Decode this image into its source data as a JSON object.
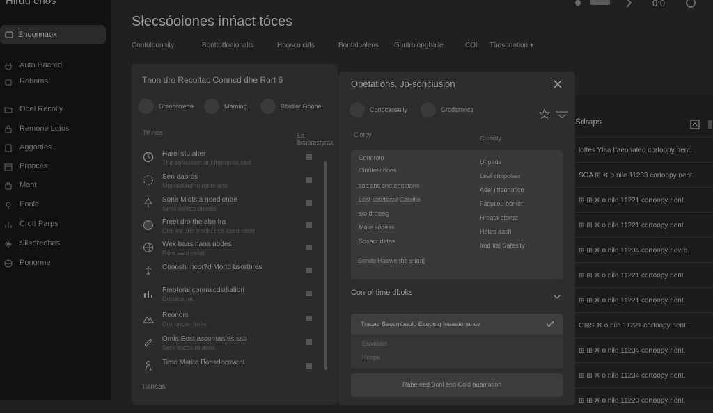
{
  "app": {
    "brand": "Hirdu enos"
  },
  "sidebar": {
    "dashboard_label": "Enoonnaox",
    "items": [
      {
        "label": "Auto Hacred",
        "icon": "plug-icon"
      },
      {
        "label": "Roboms",
        "icon": "robot-icon"
      },
      {
        "label": "Obel Recolly",
        "icon": "folder-icon"
      },
      {
        "label": "Remone Lotos",
        "icon": "lock-icon"
      },
      {
        "label": "Aggorties",
        "icon": "book-icon"
      },
      {
        "label": "Prooces",
        "icon": "calendar-icon"
      },
      {
        "label": "Mant",
        "icon": "bag-icon"
      },
      {
        "label": "Eonle",
        "icon": "pin-icon"
      },
      {
        "label": "Crott Parps",
        "icon": "bars-icon"
      },
      {
        "label": "Sileoreohes",
        "icon": "sparkle-icon"
      },
      {
        "label": "Ponorme",
        "icon": "globe-icon"
      }
    ]
  },
  "header": {
    "title": "Słecsóoiones inńact tóces",
    "tabs": [
      "Contoloonaity",
      "Bonttotfoaionalts",
      "Hoosco cilfs",
      "Bontaloalens",
      "Gontrolongbaile",
      "COl",
      "Tbosonation"
    ]
  },
  "left_panel": {
    "title": "Tnon dro Recoitac Conncd dhe Rort 6",
    "chips": [
      {
        "label": "Dreocotrerta"
      },
      {
        "label": "Marning"
      },
      {
        "label": "Bbrdiar Goone"
      }
    ],
    "list_header": "Tfl Hos",
    "list_header_right": "La bxaorestyrax",
    "rows": [
      {
        "title": "Harel stu alter",
        "sub": "The sotlaenon anf lreoteres oed",
        "icon": "clock-icon"
      },
      {
        "title": "Sen daorbs",
        "sub": "Mioosdi rorhs rotas arls",
        "icon": "gauge-icon"
      },
      {
        "title": "Sone Miots a noedlonde",
        "sub": "Sefst rorkes omnes",
        "icon": "tree-icon"
      },
      {
        "title": "Freet dro the aho fra",
        "sub": "Coe ea ornl trootu ncs aseamlent",
        "icon": "leaf-icon"
      },
      {
        "title": "Wek baas haoa ubdes",
        "sub": "Rote sate neiat",
        "icon": "globe-icon"
      },
      {
        "title": "Cooosh Incor?d Mortd bsortbres",
        "sub": "",
        "icon": "figure-icon"
      },
      {
        "title": "Pmotoral conrnscdsdiation",
        "sub": "Drtoacenan",
        "icon": "chart-icon"
      },
      {
        "title": "Reonors",
        "sub": "Drrt oncan lroke",
        "icon": "mountain-icon"
      },
      {
        "title": "Omia Eost accomaafes ssb",
        "sub": "Sers lloess ooasns",
        "icon": "paint-icon"
      },
      {
        "title": "Time Marito Bonsdecovent",
        "sub": "",
        "icon": "person-icon"
      }
    ],
    "footer": "Tiansas"
  },
  "modal": {
    "title": "Opetations. Jo-sonciusion",
    "chips": [
      {
        "label": "Conocaosally"
      },
      {
        "label": "Grodaronce"
      }
    ],
    "col_left": "Ciorcy",
    "col_right": "Ctonoty",
    "options_left": [
      "Conorolo",
      "Cinotel choos",
      "soc ahs cnd eoeatons",
      "Lost sotetonal Cacotio",
      "s/o drosing",
      "Mote aooess",
      "Sosacr detos"
    ],
    "options_right": [
      "Uhoads",
      "Leal ercipones",
      "Adel litteonatico",
      "Facptiou bsmer",
      "Hroata etortst",
      "Hotes aach",
      "Irod Ital Safesity"
    ],
    "options_summary": "Sondo Haowe the etioa]",
    "section_title": "Conrol time dboks",
    "sub_header": "Tracae Baocmbaolo Eaeoing leaaatonance",
    "sub_options": [
      "Eroauain",
      "Hcopa"
    ],
    "apply_label": "Rabe eed Bonl end Coid auaniation"
  },
  "right_panel": {
    "title": "Sdraps",
    "rows": [
      {
        "label": "lottes Ylaa Ifaeopateo cortoopy nent."
      },
      {
        "label": "SOA ⊞ ✕  o nile  11233 cortoopy nent."
      },
      {
        "label": "⊞ ⊞ ✕  o nile  11221 cortoopy nent."
      },
      {
        "label": "⊞ ⊞ ✕  o nile  11221 cortoopy nent."
      },
      {
        "label": "⊞ ⊞ ✕  o nile  11234 cortoopy nevre."
      },
      {
        "label": "⊞ ⊞ ✕  o nile  11221 cortoopy nent."
      },
      {
        "label": "⊞ ⊞ ✕  o nile  11221 cortoopy nent."
      },
      {
        "label": "O⊠S ✕  o nile  11221 cortoopy nent."
      },
      {
        "label": "⊞ ⊞ ✕  o nile  11234 cortoopy nent."
      },
      {
        "label": "⊞ ⊞ ✕  o nile  11234 cortoopy nent."
      },
      {
        "label": "⊞ ⊞ ✕  o nile  11223 cortoopy nent."
      }
    ]
  },
  "topbar": {
    "percent": "0:0"
  }
}
